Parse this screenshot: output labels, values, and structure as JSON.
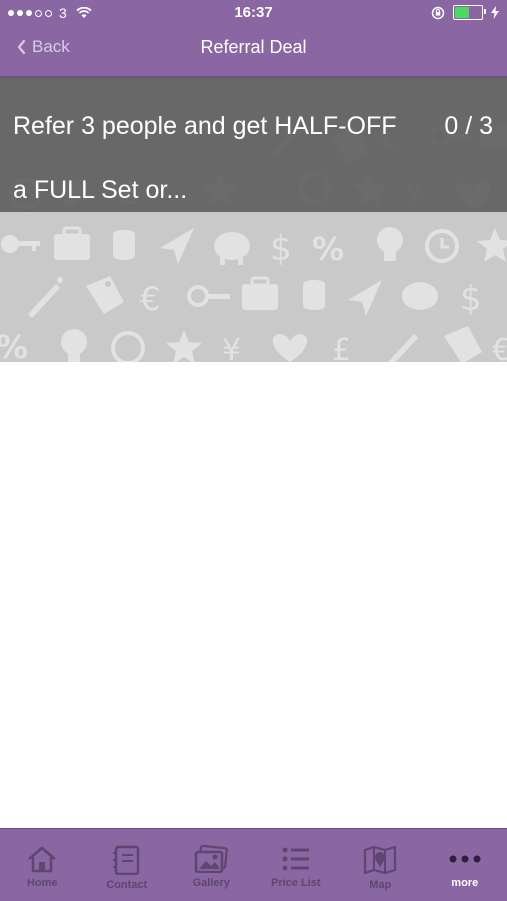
{
  "status_bar": {
    "carrier": "3",
    "time": "16:37"
  },
  "nav": {
    "back_label": "Back",
    "title": "Referral Deal"
  },
  "deal": {
    "description": "Refer 3 people and get HALF-OFF a FULL Set or...",
    "progress": "0 / 3"
  },
  "tabbar": {
    "tabs": [
      {
        "label": "Home",
        "icon": "home-icon"
      },
      {
        "label": "Contact",
        "icon": "contact-icon"
      },
      {
        "label": "Gallery",
        "icon": "gallery-icon"
      },
      {
        "label": "Price List",
        "icon": "list-icon"
      },
      {
        "label": "Map",
        "icon": "map-icon"
      },
      {
        "label": "more",
        "icon": "more-icon"
      }
    ],
    "active_index": 5
  },
  "colors": {
    "brand": "#8a67a3",
    "tab_inactive": "#5e4670",
    "panel": "#5a5a5a",
    "pattern_bg": "#c9c9ca"
  }
}
